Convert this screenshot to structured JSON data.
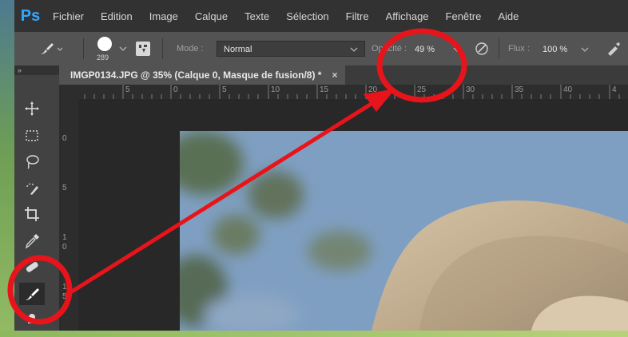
{
  "app": {
    "logo": "Ps"
  },
  "menu": [
    "Fichier",
    "Edition",
    "Image",
    "Calque",
    "Texte",
    "Sélection",
    "Filtre",
    "Affichage",
    "Fenêtre",
    "Aide"
  ],
  "options": {
    "brush_size": "289",
    "mode_label": "Mode :",
    "mode_value": "Normal",
    "opacity_label": "Opacité :",
    "opacity_value": "49 %",
    "flow_label": "Flux :",
    "flow_value": "100 %"
  },
  "document": {
    "tab_title": "IMGP0134.JPG @ 35% (Calque 0, Masque de fusion/8) *",
    "close_glyph": "×"
  },
  "ruler": {
    "top_labels": [
      "5",
      "0",
      "5",
      "10",
      "15",
      "20",
      "25",
      "30",
      "35",
      "40",
      "4"
    ],
    "left_labels": [
      "0",
      "5",
      "1",
      "0",
      "1",
      "5"
    ]
  },
  "annotation": {
    "color": "#e8141b"
  },
  "icons": [
    "brush-icon",
    "move-icon",
    "marquee-icon",
    "lasso-icon",
    "quick-selection-icon",
    "crop-icon",
    "eyedropper-icon",
    "healing-brush-icon",
    "stamp-icon",
    "airbrush-icon"
  ]
}
